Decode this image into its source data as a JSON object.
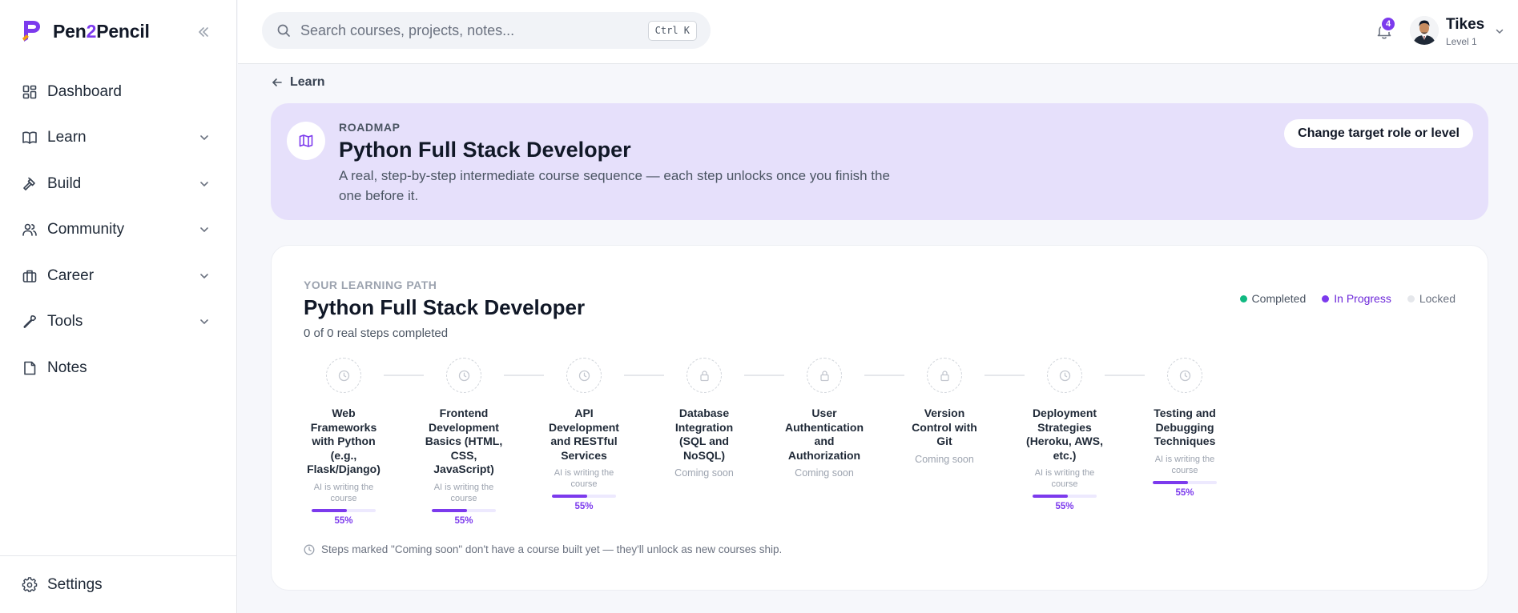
{
  "brand": {
    "name_part1": "Pen",
    "name_part2": "2",
    "name_part3": "Pencil",
    "accent": "#7c3aed"
  },
  "sidebar": {
    "collapse_icon": "double-chevron-left-icon",
    "items": [
      {
        "label": "Dashboard",
        "icon": "dashboard-icon",
        "expandable": false
      },
      {
        "label": "Learn",
        "icon": "book-icon",
        "expandable": true
      },
      {
        "label": "Build",
        "icon": "hammer-icon",
        "expandable": true
      },
      {
        "label": "Community",
        "icon": "users-icon",
        "expandable": true
      },
      {
        "label": "Career",
        "icon": "briefcase-icon",
        "expandable": true
      },
      {
        "label": "Tools",
        "icon": "wrench-icon",
        "expandable": true
      },
      {
        "label": "Notes",
        "icon": "note-icon",
        "expandable": false
      }
    ],
    "settings_label": "Settings"
  },
  "topbar": {
    "search_placeholder": "Search courses, projects, notes...",
    "search_shortcut": "Ctrl K",
    "notification_count": "4",
    "user_name": "Tikes",
    "user_level": "Level 1"
  },
  "breadcrumb": {
    "back_label": "Learn"
  },
  "hero": {
    "kicker": "ROADMAP",
    "title": "Python Full Stack Developer",
    "description": "A real, step-by-step intermediate course sequence — each step unlocks once you finish the one before it.",
    "button_label": "Change target role or level",
    "background": "#e6e0fb"
  },
  "path": {
    "kicker": "YOUR LEARNING PATH",
    "title": "Python Full Stack Developer",
    "progress_text": "0 of 0 real steps completed",
    "legend": [
      {
        "label": "Completed",
        "color": "#10b981"
      },
      {
        "label": "In Progress",
        "color": "#7c3aed"
      },
      {
        "label": "Locked",
        "color": "#e5e7eb"
      }
    ],
    "steps": [
      {
        "name": "Web Frameworks with Python (e.g., Flask/Django)",
        "icon": "clock-icon",
        "status": "AI is writing the course",
        "progress": 55,
        "progress_label": "55%"
      },
      {
        "name": "Frontend Development Basics (HTML, CSS, JavaScript)",
        "icon": "clock-icon",
        "status": "AI is writing the course",
        "progress": 55,
        "progress_label": "55%"
      },
      {
        "name": "API Development and RESTful Services",
        "icon": "clock-icon",
        "status": "AI is writing the course",
        "progress": 55,
        "progress_label": "55%"
      },
      {
        "name": "Database Integration (SQL and NoSQL)",
        "icon": "lock-icon",
        "status": "Coming soon",
        "progress": null,
        "progress_label": ""
      },
      {
        "name": "User Authentication and Authorization",
        "icon": "lock-icon",
        "status": "Coming soon",
        "progress": null,
        "progress_label": ""
      },
      {
        "name": "Version Control with Git",
        "icon": "lock-icon",
        "status": "Coming soon",
        "progress": null,
        "progress_label": ""
      },
      {
        "name": "Deployment Strategies (Heroku, AWS, etc.)",
        "icon": "clock-icon",
        "status": "AI is writing the course",
        "progress": 55,
        "progress_label": "55%"
      },
      {
        "name": "Testing and Debugging Techniques",
        "icon": "clock-icon",
        "status": "AI is writing the course",
        "progress": 55,
        "progress_label": "55%"
      }
    ],
    "footnote": "Steps marked \"Coming soon\" don't have a course built yet — they'll unlock as new courses ship."
  }
}
